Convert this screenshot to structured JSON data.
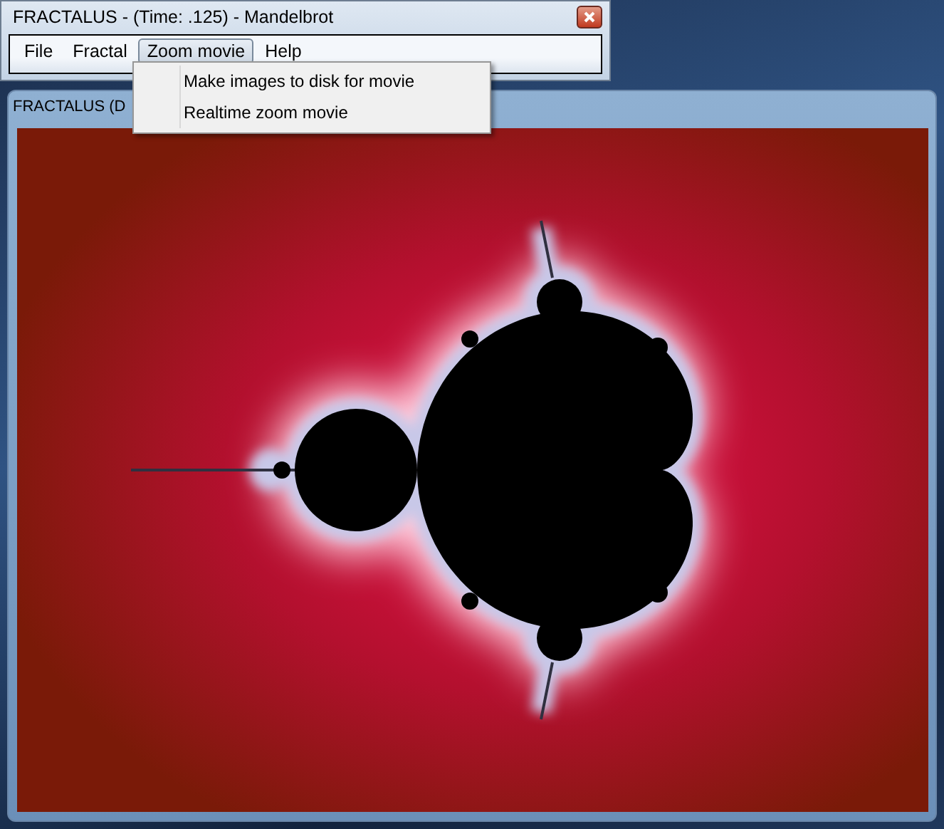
{
  "front_window": {
    "title": "FRACTALUS - (Time: .125) - Mandelbrot",
    "menu": [
      {
        "label": "File",
        "selected": false
      },
      {
        "label": "Fractal",
        "selected": false
      },
      {
        "label": "Zoom movie",
        "selected": true
      },
      {
        "label": "Help",
        "selected": false
      }
    ]
  },
  "dropdown": {
    "items": [
      "Make images to disk for movie",
      "Realtime zoom movie"
    ]
  },
  "back_window": {
    "title": "FRACTALUS (D"
  }
}
